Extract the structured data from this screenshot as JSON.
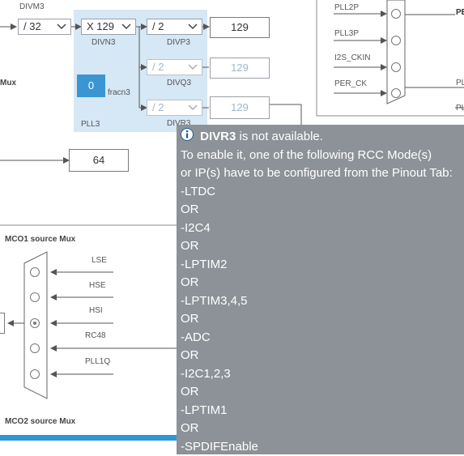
{
  "pll3": {
    "divm3_label": "DIVM3",
    "divm3_value": "/ 32",
    "divn3_label": "DIVN3",
    "divn3_value": "X 129",
    "divp3_label": "DIVP3",
    "divp3_value": "/ 2",
    "divp3_output": "129",
    "divq3_label": "DIVQ3",
    "divq3_value": "/ 2",
    "divq3_output": "129",
    "divr3_label": "DIVR3",
    "divr3_value": "/ 2",
    "divr3_output": "129",
    "fracn3_value": "0",
    "fracn3_label": "fracn3",
    "block_label": "PLL3"
  },
  "left_mux_label": "Mux",
  "freq_box_value": "64",
  "right_mux": {
    "inputs": [
      "PLL2P",
      "PLL3P",
      "I2S_CKIN",
      "PER_CK"
    ],
    "partial_labels": [
      "PE",
      "PL",
      "PL"
    ]
  },
  "mco1": {
    "title": "MCO1 source Mux",
    "inputs": [
      "LSE",
      "HSE",
      "HSI",
      "RC48",
      "PLL1Q"
    ],
    "selected_index": 2
  },
  "mco2": {
    "title": "MCO2 source Mux"
  },
  "colors": {
    "pll_bg": "#d6e7f5",
    "fracn_fill": "#3a96d2",
    "tooltip_bg": "#8c9297",
    "bar": "#2f97d6"
  },
  "tooltip": {
    "title_bold": "DIVR3",
    "title_rest": " is not available.",
    "line1": "To enable it, one of the following RCC Mode(s)",
    "line2": "or IP(s) have to be configured from the Pinout Tab:",
    "items": [
      "-LTDC",
      "OR",
      "-I2C4",
      "OR",
      "-LPTIM2",
      "OR",
      "-LPTIM3,4,5",
      "OR",
      "-ADC",
      "OR",
      "-I2C1,2,3",
      "OR",
      "-LPTIM1",
      "OR",
      "-SPDIFEnable"
    ]
  }
}
